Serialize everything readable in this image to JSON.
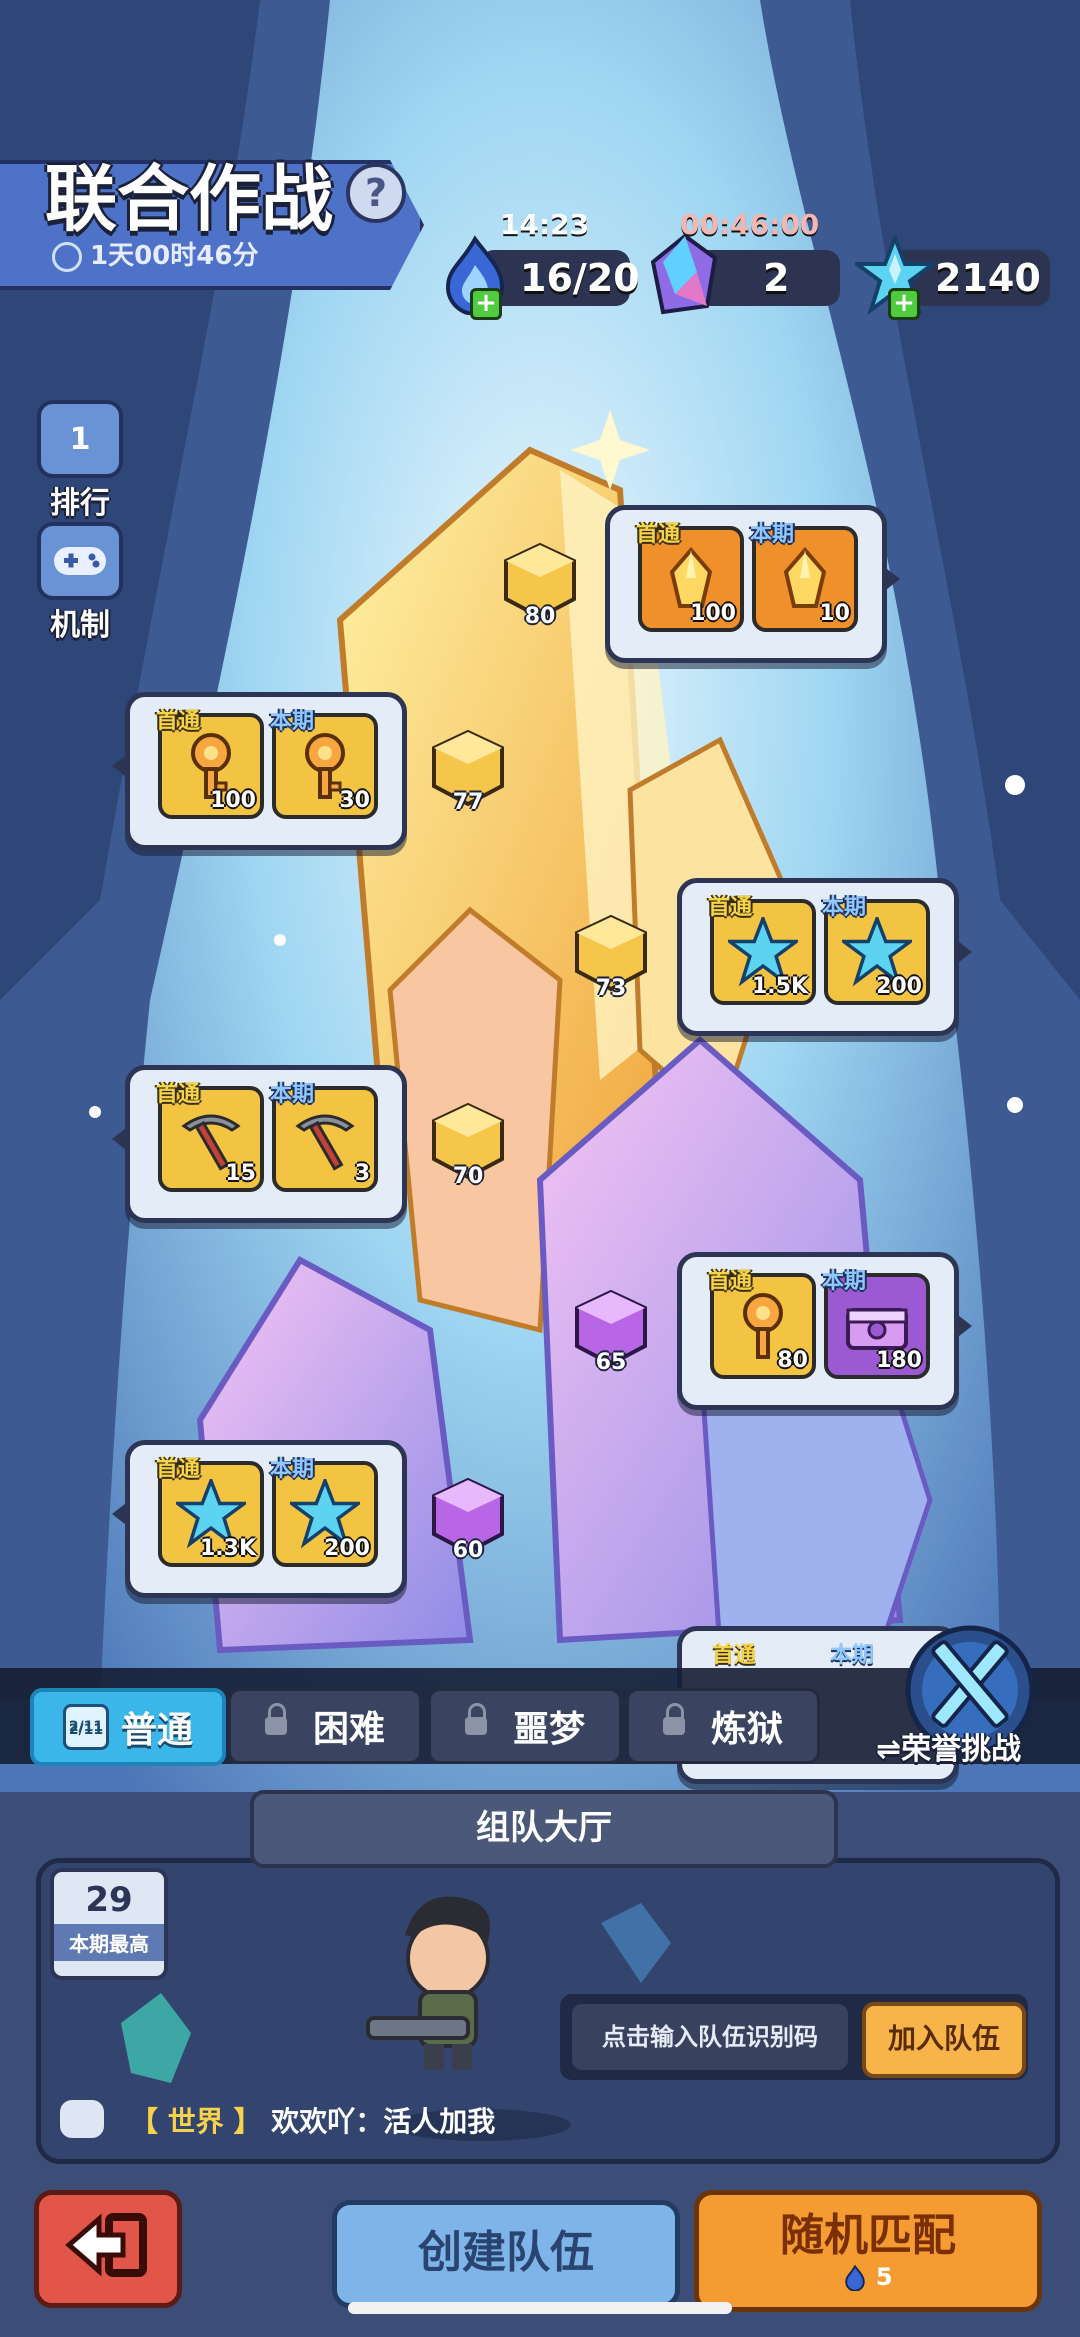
{
  "header": {
    "title": "联合作战",
    "help_icon": "question-mark-icon",
    "countdown": "1天00时46分"
  },
  "resources": [
    {
      "icon": "blue-flame-icon",
      "timer": "14:23",
      "value": "16/20",
      "timer_color": "#ffffff"
    },
    {
      "icon": "purple-crystal-icon",
      "timer": "00:46:00",
      "value": "2",
      "timer_color": "#f4b6b0"
    },
    {
      "icon": "blue-star-crystal-icon",
      "timer": "",
      "value": "2140",
      "timer_color": "#ffffff"
    }
  ],
  "side_menu": [
    {
      "icon": "trophy-icon",
      "label": "排行"
    },
    {
      "icon": "gamepad-icon",
      "label": "机制"
    }
  ],
  "stages": [
    {
      "level": "80",
      "node_color": "gold",
      "rewards": [
        {
          "tag": "首通",
          "item": "gold-crystal-icon",
          "qty": "100",
          "bg": "orange"
        },
        {
          "tag": "本期",
          "item": "gold-crystal-icon",
          "qty": "10",
          "bg": "orange"
        }
      ]
    },
    {
      "level": "77",
      "node_color": "gold",
      "rewards": [
        {
          "tag": "首通",
          "item": "key-icon",
          "qty": "100",
          "bg": "gold"
        },
        {
          "tag": "本期",
          "item": "key-icon",
          "qty": "30",
          "bg": "gold"
        }
      ]
    },
    {
      "level": "73",
      "node_color": "gold",
      "rewards": [
        {
          "tag": "首通",
          "item": "blue-star-crystal-icon",
          "qty": "1.5K",
          "bg": "gold"
        },
        {
          "tag": "本期",
          "item": "blue-star-crystal-icon",
          "qty": "200",
          "bg": "gold"
        }
      ]
    },
    {
      "level": "70",
      "node_color": "gold",
      "rewards": [
        {
          "tag": "首通",
          "item": "pickaxe-icon",
          "qty": "15",
          "bg": "gold"
        },
        {
          "tag": "本期",
          "item": "pickaxe-icon",
          "qty": "3",
          "bg": "gold"
        }
      ]
    },
    {
      "level": "65",
      "node_color": "purple",
      "rewards": [
        {
          "tag": "首通",
          "item": "key-icon",
          "qty": "80",
          "bg": "gold"
        },
        {
          "tag": "本期",
          "item": "purple-chest-icon",
          "qty": "180",
          "bg": "purple"
        }
      ]
    },
    {
      "level": "60",
      "node_color": "purple",
      "rewards": [
        {
          "tag": "首通",
          "item": "blue-star-crystal-icon",
          "qty": "1.3K",
          "bg": "gold"
        },
        {
          "tag": "本期",
          "item": "blue-star-crystal-icon",
          "qty": "200",
          "bg": "gold"
        }
      ]
    }
  ],
  "partial_card": {
    "tag1": "首通",
    "tag2": "本期"
  },
  "difficulty_tabs": [
    {
      "label": "普通",
      "badge": "2/11",
      "locked": false,
      "active": true
    },
    {
      "label": "困难",
      "locked": true,
      "active": false
    },
    {
      "label": "噩梦",
      "locked": true,
      "active": false
    },
    {
      "label": "炼狱",
      "locked": true,
      "active": false
    }
  ],
  "honor": {
    "label": "⇌荣誉挑战",
    "icon": "crossed-swords-icon"
  },
  "team_hall": {
    "title": "组队大厅",
    "best_value": "29",
    "best_label": "本期最高",
    "code_placeholder": "点击输入队伍识别码",
    "join_label": "加入队伍",
    "chat_channel": "【 世界 】",
    "chat_message": "欢欢吖：活人加我"
  },
  "bottom": {
    "back_icon": "exit-arrow-icon",
    "create_label": "创建队伍",
    "random_label": "随机匹配",
    "random_cost": "5",
    "random_cost_icon": "blue-flame-icon"
  },
  "colors": {
    "gold_slot": "#f2c441",
    "orange_slot": "#f0902a",
    "purple_slot": "#9b5ad2",
    "active_tab": "#3ab6e8",
    "random_button": "#f49b32"
  }
}
